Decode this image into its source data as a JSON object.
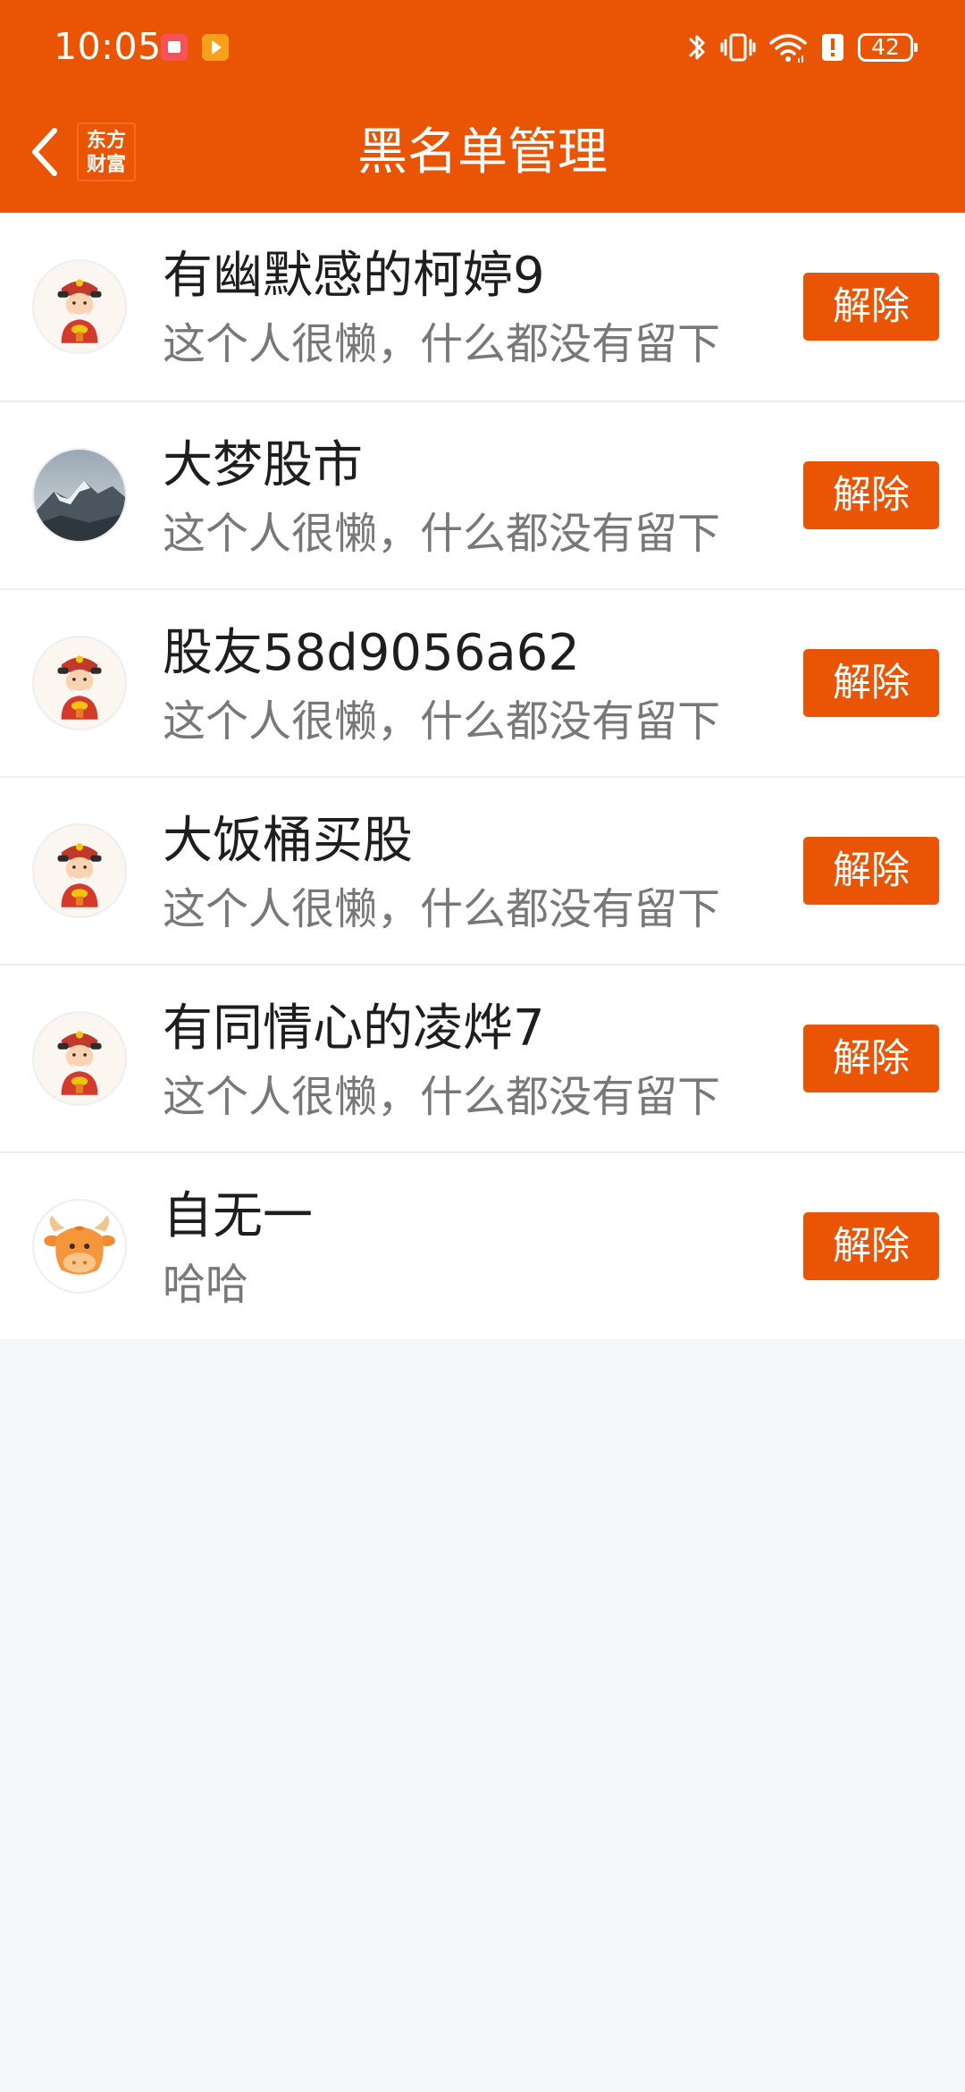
{
  "status_bar": {
    "time": "10:05",
    "battery_level": "42",
    "icons": [
      "bookshelf-app-icon",
      "video-app-icon",
      "bluetooth-icon",
      "vibrate-icon",
      "wifi-icon",
      "alert-icon",
      "battery-icon"
    ]
  },
  "header": {
    "title": "黑名单管理",
    "logo_line1": "东方",
    "logo_line2": "财富",
    "back_icon": "chevron-left-icon"
  },
  "colors": {
    "accent": "#e95504",
    "background": "#f5f6f8",
    "name_text": "#1e1e1e",
    "desc_text": "#787878"
  },
  "blacklist": {
    "items": [
      {
        "name": "有幽默感的柯婷9",
        "description": "这个人很懒，什么都没有留下",
        "button_label": "解除",
        "avatar": "god-of-wealth-avatar"
      },
      {
        "name": "大梦股市",
        "description": "这个人很懒，什么都没有留下",
        "button_label": "解除",
        "avatar": "mountain-photo-avatar"
      },
      {
        "name": "股友58d9056a62",
        "description": "这个人很懒，什么都没有留下",
        "button_label": "解除",
        "avatar": "god-of-wealth-avatar"
      },
      {
        "name": "大饭桶买股",
        "description": "这个人很懒，什么都没有留下",
        "button_label": "解除",
        "avatar": "god-of-wealth-avatar"
      },
      {
        "name": "有同情心的凌烨7",
        "description": "这个人很懒，什么都没有留下",
        "button_label": "解除",
        "avatar": "god-of-wealth-avatar"
      },
      {
        "name": "自无一",
        "description": "哈哈",
        "button_label": "解除",
        "avatar": "bull-avatar"
      }
    ]
  }
}
